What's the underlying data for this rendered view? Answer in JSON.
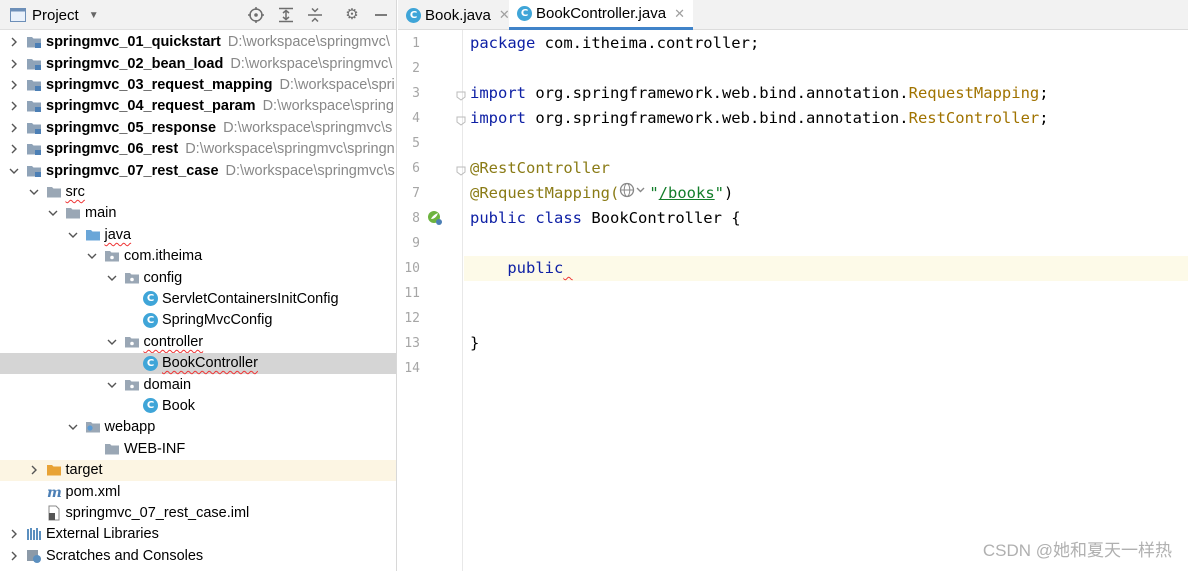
{
  "project": {
    "title": "Project",
    "tree": [
      {
        "label": "springmvc_01_quickstart",
        "path": "D:\\workspace\\springmvc\\",
        "bold": true,
        "depth": 0,
        "chevron": "right",
        "icon": "module-folder-icon"
      },
      {
        "label": "springmvc_02_bean_load",
        "path": "D:\\workspace\\springmvc\\",
        "bold": true,
        "depth": 0,
        "chevron": "right",
        "icon": "module-folder-icon"
      },
      {
        "label": "springmvc_03_request_mapping",
        "path": "D:\\workspace\\spri",
        "bold": true,
        "depth": 0,
        "chevron": "right",
        "icon": "module-folder-icon"
      },
      {
        "label": "springmvc_04_request_param",
        "path": "D:\\workspace\\spring",
        "bold": true,
        "depth": 0,
        "chevron": "right",
        "icon": "module-folder-icon"
      },
      {
        "label": "springmvc_05_response",
        "path": "D:\\workspace\\springmvc\\s",
        "bold": true,
        "depth": 0,
        "chevron": "right",
        "icon": "module-folder-icon"
      },
      {
        "label": "springmvc_06_rest",
        "path": "D:\\workspace\\springmvc\\springn",
        "bold": true,
        "depth": 0,
        "chevron": "right",
        "icon": "module-folder-icon"
      },
      {
        "label": "springmvc_07_rest_case",
        "path": "D:\\workspace\\springmvc\\s",
        "bold": true,
        "depth": 0,
        "chevron": "down",
        "icon": "module-folder-icon"
      },
      {
        "label": "src",
        "depth": 1,
        "chevron": "down",
        "icon": "folder-icon"
      },
      {
        "label": "main",
        "depth": 2,
        "chevron": "down",
        "icon": "folder-icon"
      },
      {
        "label": "java",
        "depth": 3,
        "chevron": "down",
        "icon": "source-folder-icon"
      },
      {
        "label": "com.itheima",
        "depth": 4,
        "chevron": "down",
        "icon": "package-icon"
      },
      {
        "label": "config",
        "depth": 5,
        "chevron": "down",
        "icon": "package-icon"
      },
      {
        "label": "ServletContainersInitConfig",
        "depth": 6,
        "chevron": "none",
        "icon": "class-icon"
      },
      {
        "label": "SpringMvcConfig",
        "depth": 6,
        "chevron": "none",
        "icon": "class-icon"
      },
      {
        "label": "controller",
        "depth": 5,
        "chevron": "down",
        "icon": "package-icon"
      },
      {
        "label": "BookController",
        "depth": 6,
        "chevron": "none",
        "icon": "class-icon",
        "selected": true
      },
      {
        "label": "domain",
        "depth": 5,
        "chevron": "down",
        "icon": "package-icon"
      },
      {
        "label": "Book",
        "depth": 6,
        "chevron": "none",
        "icon": "class-icon"
      },
      {
        "label": "webapp",
        "depth": 3,
        "chevron": "down",
        "icon": "web-folder-icon"
      },
      {
        "label": "WEB-INF",
        "depth": 4,
        "chevron": "none",
        "icon": "folder-icon"
      },
      {
        "label": "target",
        "depth": 1,
        "chevron": "right",
        "icon": "excluded-folder-icon",
        "highlight": true
      },
      {
        "label": "pom.xml",
        "depth": 1,
        "chevron": "none",
        "icon": "maven-icon"
      },
      {
        "label": "springmvc_07_rest_case.iml",
        "depth": 1,
        "chevron": "none",
        "icon": "iml-file-icon"
      },
      {
        "label": "External Libraries",
        "depth": 0,
        "chevron": "right",
        "icon": "libraries-icon"
      },
      {
        "label": "Scratches and Consoles",
        "depth": 0,
        "chevron": "right",
        "icon": "scratches-icon"
      }
    ]
  },
  "editor": {
    "tabs": [
      {
        "label": "Book.java",
        "active": false
      },
      {
        "label": "BookController.java",
        "active": true
      }
    ],
    "line_numbers": [
      "1",
      "2",
      "3",
      "4",
      "5",
      "6",
      "7",
      "8",
      "9",
      "10",
      "11",
      "12",
      "13",
      "14"
    ],
    "current_line": 10,
    "lines": [
      [
        {
          "t": "package ",
          "c": "kw"
        },
        {
          "t": "com.itheima.controller;",
          "c": "plain"
        }
      ],
      [],
      [
        {
          "t": "import ",
          "c": "kw"
        },
        {
          "t": "org.springframework.web.bind.annotation.",
          "c": "plain"
        },
        {
          "t": "RequestMapping",
          "c": "cls"
        },
        {
          "t": ";",
          "c": "plain"
        }
      ],
      [
        {
          "t": "import ",
          "c": "kw"
        },
        {
          "t": "org.springframework.web.bind.annotation.",
          "c": "plain"
        },
        {
          "t": "RestController",
          "c": "cls"
        },
        {
          "t": ";",
          "c": "plain"
        }
      ],
      [],
      [
        {
          "t": "@RestController",
          "c": "ann"
        }
      ],
      [
        {
          "t": "@RequestMapping(",
          "c": "ann"
        },
        {
          "t": "ICON",
          "c": "icon"
        },
        {
          "t": "\"",
          "c": "str"
        },
        {
          "t": "/books",
          "c": "str-link"
        },
        {
          "t": "\"",
          "c": "str"
        },
        {
          "t": ")",
          "c": "plain"
        }
      ],
      [
        {
          "t": "public class ",
          "c": "kw"
        },
        {
          "t": "BookController {",
          "c": "plain"
        }
      ],
      [],
      [
        {
          "t": "    ",
          "c": "plain"
        },
        {
          "t": "public",
          "c": "kw"
        },
        {
          "t": " ",
          "c": "plain"
        }
      ],
      [],
      [],
      [
        {
          "t": "}",
          "c": "plain"
        }
      ],
      []
    ]
  },
  "watermark": "CSDN @她和夏天一样热"
}
